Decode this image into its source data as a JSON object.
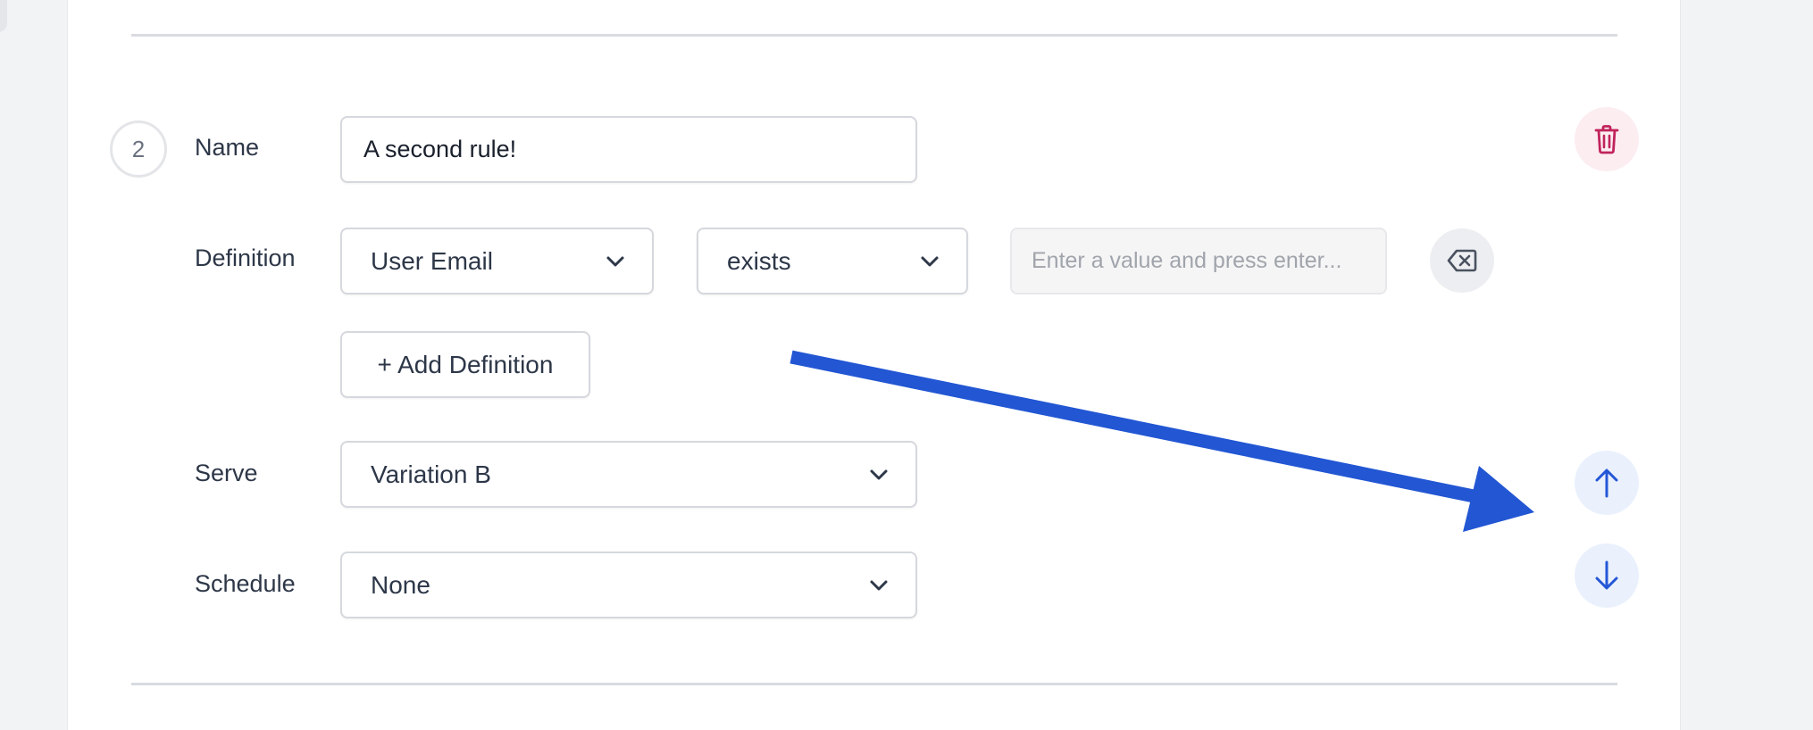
{
  "rule": {
    "step_number": "2",
    "name_label": "Name",
    "name_value": "A second rule!",
    "definition_label": "Definition",
    "definition": {
      "attribute": "User Email",
      "operator": "exists",
      "value_placeholder": "Enter a value and press enter..."
    },
    "add_definition_label": "+ Add Definition",
    "serve_label": "Serve",
    "serve_value": "Variation B",
    "schedule_label": "Schedule",
    "schedule_value": "None"
  },
  "icons": {
    "delete": "trash-icon",
    "clear": "backspace-icon",
    "move_up": "arrow-up-icon",
    "move_down": "arrow-down-icon",
    "dropdown": "chevron-down-icon"
  },
  "colors": {
    "delete_accent": "#c0245c",
    "move_accent": "#2456d6",
    "annotation_arrow": "#2256d3"
  }
}
